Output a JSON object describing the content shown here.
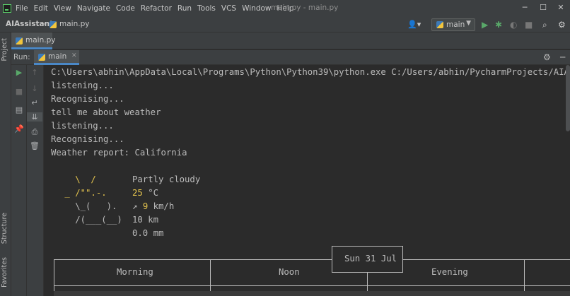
{
  "menubar": {
    "items": [
      "File",
      "Edit",
      "View",
      "Navigate",
      "Code",
      "Refactor",
      "Run",
      "Tools",
      "VCS",
      "Window",
      "Help"
    ],
    "window_title": "main.py - main.py"
  },
  "navbar": {
    "project": "AIAssistant",
    "file": "main.py",
    "run_config": "main"
  },
  "editor": {
    "tab": "main.py"
  },
  "left_strip": {
    "project_tab": "Project",
    "structure_tab": "Structure",
    "favorites_tab": "Favorites"
  },
  "run_panel": {
    "label": "Run:",
    "tab": "main"
  },
  "console": {
    "lines": [
      "C:\\Users\\abhin\\AppData\\Local\\Programs\\Python\\Python39\\python.exe C:/Users/abhin/PycharmProjects/AIAssistant/main.py",
      "listening...",
      "Recognising...",
      "tell me about weather",
      "listening...",
      "Recognising...",
      "Weather report: California"
    ],
    "art": [
      "   \\  /",
      " _ /\"\".-.",
      "   \\_(   ).",
      "   /(___(__)"
    ],
    "weather": {
      "condition": "Partly cloudy",
      "temp_value": "25",
      "temp_unit": " °C",
      "wind_arrow": "↗",
      "wind_value": "9",
      "wind_unit": " km/h",
      "visibility": "10 km",
      "precipitation": "0.0 mm"
    },
    "table": {
      "date": "Sun 31 Jul",
      "headers": [
        "Morning",
        "Noon",
        "Evening"
      ]
    }
  },
  "colors": {
    "accent": "#4a88c7",
    "run_green": "#59a869",
    "highlight_yellow": "#e4c44e"
  }
}
